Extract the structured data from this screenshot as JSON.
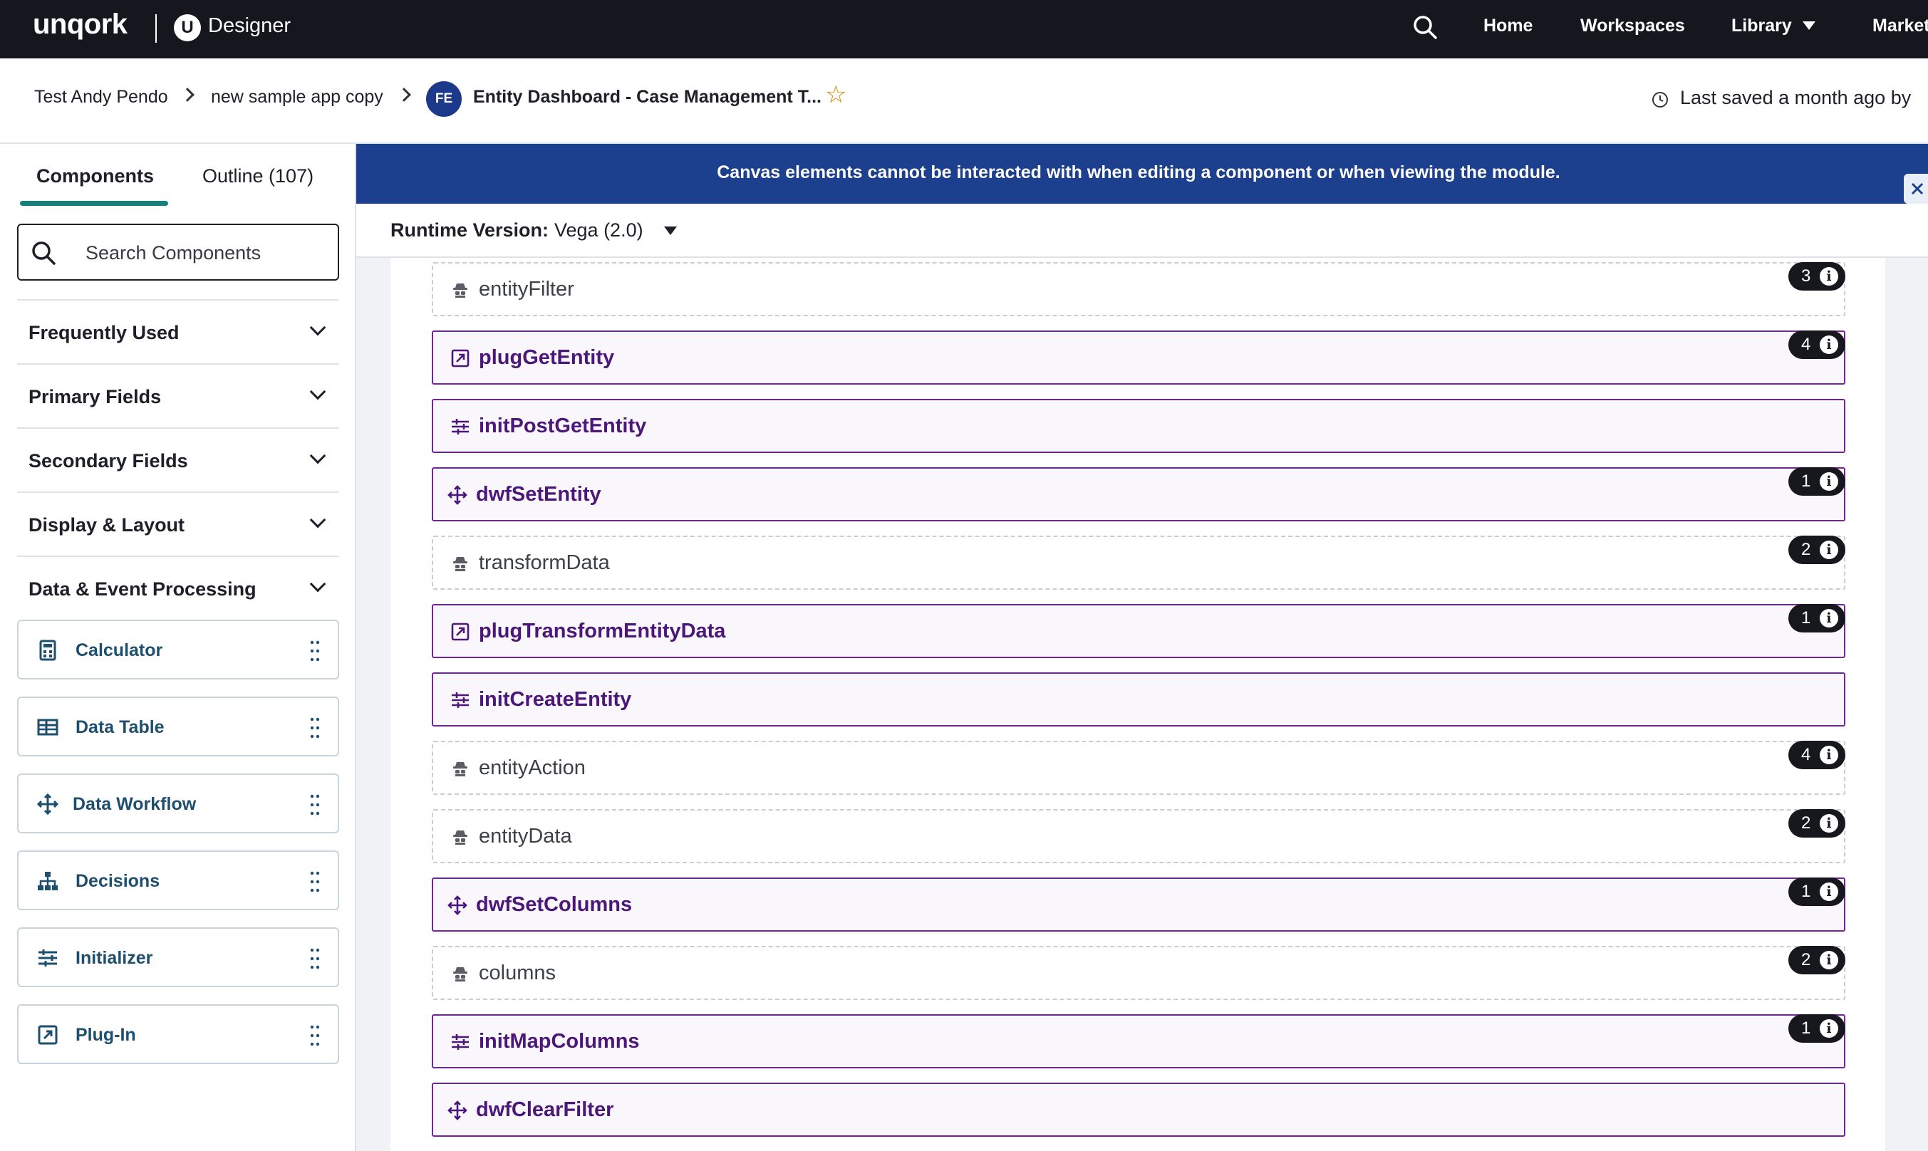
{
  "topbar": {
    "logo": "unqork",
    "designer_mark": "U",
    "designer_label": "Designer",
    "nav": [
      "Home",
      "Workspaces",
      "Library",
      "Market"
    ]
  },
  "breadcrumb": {
    "items": [
      "Test Andy Pendo",
      "new sample app copy"
    ],
    "module_badge": "FE",
    "module_title": "Entity Dashboard - Case Management T...",
    "saved_text": "Last saved a month ago by"
  },
  "left_panel": {
    "tabs": [
      "Components",
      "Outline (107)"
    ],
    "search_placeholder": "Search Components",
    "categories": [
      "Frequently Used",
      "Primary Fields",
      "Secondary Fields",
      "Display & Layout",
      "Data & Event Processing"
    ],
    "components": [
      {
        "label": "Calculator",
        "icon": "calculator-icon"
      },
      {
        "label": "Data Table",
        "icon": "data-table-icon"
      },
      {
        "label": "Data Workflow",
        "icon": "data-workflow-icon"
      },
      {
        "label": "Decisions",
        "icon": "decisions-icon"
      },
      {
        "label": "Initializer",
        "icon": "initializer-icon"
      },
      {
        "label": "Plug-In",
        "icon": "plug-in-icon"
      }
    ]
  },
  "canvas": {
    "banner": "Canvas elements cannot be interacted with when editing a component or when viewing the module.",
    "runtime_label": "Runtime Version:",
    "runtime_value": "Vega (2.0)",
    "rows": [
      {
        "label": "entityFilter",
        "type": "hidden",
        "icon": "hidden-component-icon",
        "badge": "3"
      },
      {
        "label": "plugGetEntity",
        "type": "plugin",
        "icon": "plug-in-icon",
        "badge": "4"
      },
      {
        "label": "initPostGetEntity",
        "type": "initializer",
        "icon": "initializer-icon",
        "badge": ""
      },
      {
        "label": "dwfSetEntity",
        "type": "workflow",
        "icon": "data-workflow-icon",
        "badge": "1"
      },
      {
        "label": "transformData",
        "type": "hidden",
        "icon": "hidden-component-icon",
        "badge": "2"
      },
      {
        "label": "plugTransformEntityData",
        "type": "plugin",
        "icon": "plug-in-icon",
        "badge": "1"
      },
      {
        "label": "initCreateEntity",
        "type": "initializer",
        "icon": "initializer-icon",
        "badge": ""
      },
      {
        "label": "entityAction",
        "type": "hidden",
        "icon": "hidden-component-icon",
        "badge": "4"
      },
      {
        "label": "entityData",
        "type": "hidden",
        "icon": "hidden-component-icon",
        "badge": "2"
      },
      {
        "label": "dwfSetColumns",
        "type": "workflow",
        "icon": "data-workflow-icon",
        "badge": "1"
      },
      {
        "label": "columns",
        "type": "hidden",
        "icon": "hidden-component-icon",
        "badge": "2"
      },
      {
        "label": "initMapColumns",
        "type": "initializer",
        "icon": "initializer-icon",
        "badge": "1"
      },
      {
        "label": "dwfClearFilter",
        "type": "workflow",
        "icon": "data-workflow-icon",
        "badge": ""
      }
    ]
  },
  "colors": {
    "topbar": "#16161f",
    "banner": "#1c3f8e",
    "accent_teal": "#14807d",
    "component_purple": "#4b1778"
  }
}
